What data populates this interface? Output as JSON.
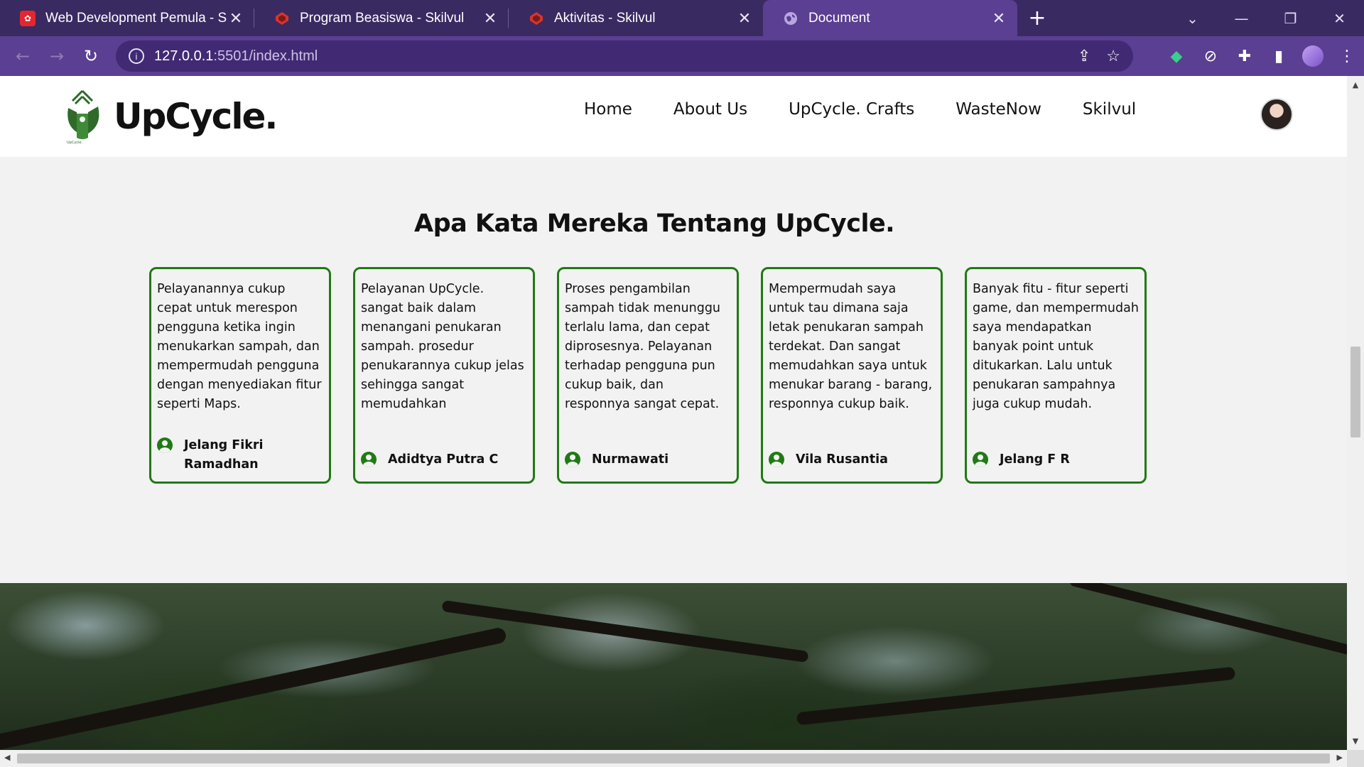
{
  "browser": {
    "tabs": [
      {
        "title": "Web Development Pemula - Spe",
        "icon": "dicoding-icon",
        "active": false
      },
      {
        "title": "Program Beasiswa - Skilvul",
        "icon": "skilvul-icon",
        "active": false
      },
      {
        "title": "Aktivitas - Skilvul",
        "icon": "skilvul-icon",
        "active": false
      },
      {
        "title": "Document",
        "icon": "globe-icon",
        "active": true
      }
    ],
    "url_host": "127.0.0.1",
    "url_path": ":5501/index.html",
    "colors": {
      "frame": "#3a2a62",
      "toolbar": "#5b3f92"
    }
  },
  "site": {
    "brand": "UpCycle.",
    "nav": [
      "Home",
      "About Us",
      "UpCycle. Crafts",
      "WasteNow",
      "Skilvul"
    ],
    "accent": "#207a14"
  },
  "testimonials": {
    "title": "Apa Kata Mereka Tentang UpCycle.",
    "items": [
      {
        "text": "Pelayanannya cukup cepat untuk merespon pengguna ketika ingin menukarkan sampah, dan mempermudah pengguna dengan menyediakan fitur seperti Maps.",
        "name": "Jelang Fikri Ramadhan"
      },
      {
        "text": "Pelayanan UpCycle. sangat baik dalam menangani penukaran sampah. prosedur penukarannya cukup jelas sehingga sangat memudahkan",
        "name": "Adidtya Putra C"
      },
      {
        "text": "Proses pengambilan sampah tidak menunggu terlalu lama, dan cepat diprosesnya. Pelayanan terhadap pengguna pun cukup baik, dan responnya sangat cepat.",
        "name": "Nurmawati"
      },
      {
        "text": "Mempermudah saya untuk tau dimana saja letak penukaran sampah terdekat. Dan sangat memudahkan saya untuk menukar barang - barang, responnya cukup baik.",
        "name": "Vila Rusantia"
      },
      {
        "text": "Banyak fitu - fitur seperti game, dan mempermudah saya mendapatkan banyak point untuk ditukarkan. Lalu untuk penukaran sampahnya juga cukup mudah.",
        "name": "Jelang F R"
      }
    ]
  }
}
